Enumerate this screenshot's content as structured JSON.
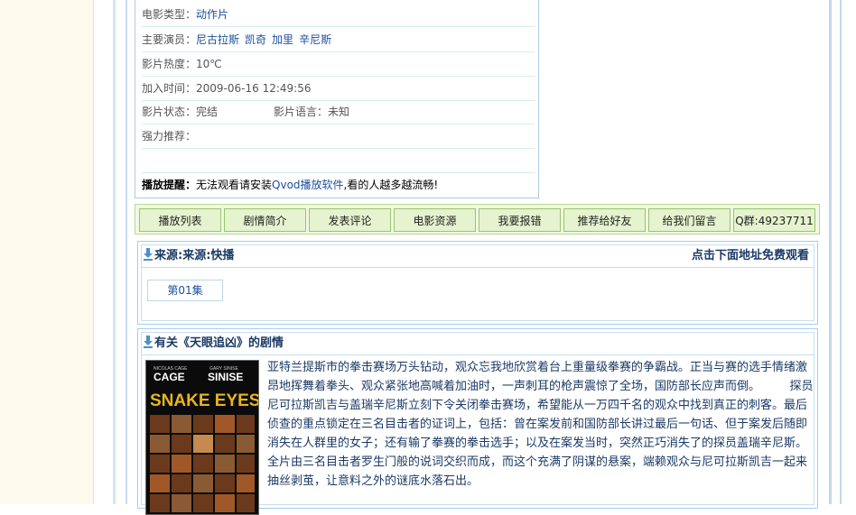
{
  "info": {
    "genre_label": "电影类型：",
    "genre_value": "动作片",
    "cast_label": "主要演员：",
    "cast": [
      "尼古拉斯",
      "凯奇",
      "加里",
      "辛尼斯"
    ],
    "heat_label": "影片热度：",
    "heat_value": "10℃",
    "added_label": "加入时间：",
    "added_value": "2009-06-16 12:49:56",
    "status_label": "影片状态：",
    "status_value": "完结",
    "language_label": "影片语言：",
    "language_value": "未知",
    "recommend_label": "强力推荐：",
    "recommend_value": "",
    "tip_label": "播放提醒：",
    "tip_text_before": "无法观看请安装",
    "tip_link": "Qvod播放软件",
    "tip_text_after": ",看的人越多越流畅!"
  },
  "tabs": [
    {
      "label": "播放列表"
    },
    {
      "label": "剧情简介"
    },
    {
      "label": "发表评论"
    },
    {
      "label": "电影资源"
    },
    {
      "label": "我要报错"
    },
    {
      "label": "推荐给好友"
    },
    {
      "label": "给我们留言"
    },
    {
      "label": "Q群:49237711"
    }
  ],
  "source": {
    "title": "来源:来源:快播",
    "right_text": "点击下面地址免费观看",
    "episode": "第01集"
  },
  "plot": {
    "title": "有关《天眼追凶》的剧情",
    "poster_actor1": "NICOLAS CAGE",
    "poster_actor2": "GARY SINISE",
    "poster_title": "SNAKE EYES",
    "text": "亚特兰提斯市的拳击赛场万头钻动，观众忘我地欣赏着台上重量级拳赛的争霸战。正当与赛的选手情绪激昂地挥舞着拳头、观众紧张地高喊着加油时，一声刺耳的枪声震惊了全场，国防部长应声而倒。　　　探员尼可拉斯凯吉与盖瑞辛尼斯立刻下令关闭拳击赛场，希望能从一万四千名的观众中找到真正的刺客。最后侦查的重点锁定在三名目击者的证词上，包括：曾在案发前和国防部长讲过最后一句话、但于案发后随即消失在人群里的女子；还有输了拳赛的拳击选手；以及在案发当时，突然正巧消失了的探员盖瑞辛尼斯。　　　全片由三名目击者罗生门般的说词交织而成，而这个充满了阴谋的悬案，端赖观众与尼可拉斯凯吉一起来抽丝剥茧，让意料之外的谜底水落石出。"
  },
  "colors": {
    "link": "#1b4f9e",
    "border_blue": "#a9cde3",
    "tab_green": "#e5f3cf",
    "tab_border": "#9ac46d",
    "left_panel": "#fcfbed"
  }
}
